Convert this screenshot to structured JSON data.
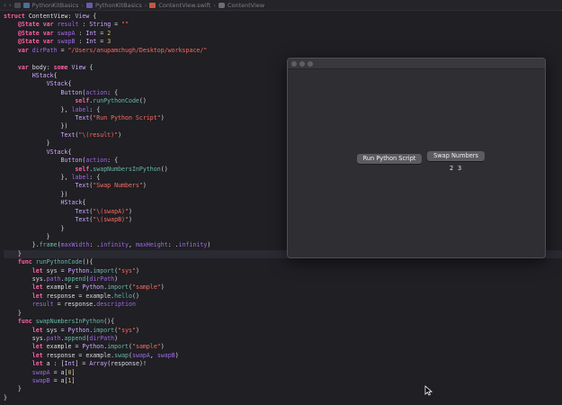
{
  "breadcrumb": {
    "items": [
      {
        "label": "PythonKitBasics",
        "icon": "project-icon"
      },
      {
        "label": "PythonKitBasics",
        "icon": "folder-icon"
      },
      {
        "label": "ContentView.swift",
        "icon": "swift-file-icon"
      },
      {
        "label": "ContentView",
        "icon": "struct-icon"
      }
    ]
  },
  "code": {
    "lines": [
      "struct ContentView: View {",
      "    @State var result : String = \"\"",
      "    @State var swapA : Int = 2",
      "    @State var swapB : Int = 3",
      "    var dirPath = \"/Users/anupamchugh/Desktop/workspace/\"",
      "",
      "    var body: some View {",
      "        HStack{",
      "            VStack{",
      "                Button(action: {",
      "                    self.runPythonCode()",
      "                }, label: {",
      "                    Text(\"Run Python Script\")",
      "                })",
      "                Text(\"\\(result)\")",
      "            }",
      "            VStack{",
      "                Button(action: {",
      "                    self.swapNumbersInPython()",
      "                }, label: {",
      "                    Text(\"Swap Numbers\")",
      "                })",
      "                HStack{",
      "                    Text(\"\\(swapA)\")",
      "                    Text(\"\\(swapB)\")",
      "                }",
      "            }",
      "        }.frame(maxWidth: .infinity, maxHeight: .infinity)",
      "    }",
      "    func runPythonCode(){",
      "        let sys = Python.import(\"sys\")",
      "        sys.path.append(dirPath)",
      "        let example = Python.import(\"sample\")",
      "        let response = example.hello()",
      "        result = response.description",
      "    }",
      "    func swapNumbersInPython(){",
      "        let sys = Python.import(\"sys\")",
      "        sys.path.append(dirPath)",
      "        let example = Python.import(\"sample\")",
      "        let response = example.swap(swapA, swapB)",
      "        let a : [Int] = Array(response)!",
      "        swapA = a[0]",
      "        swapB = a[1]",
      "    }",
      "}"
    ],
    "current_line": 28
  },
  "preview": {
    "run_button_label": "Run Python Script",
    "swap_button_label": "Swap Numbers",
    "result_text": "",
    "swap_a": "2",
    "swap_b": "3"
  },
  "colors": {
    "keyword": "#fc5fa3",
    "string": "#fc6a5d",
    "number": "#d0bf69",
    "type": "#d0a8ff",
    "function": "#67b7a4",
    "property": "#a167e6"
  }
}
